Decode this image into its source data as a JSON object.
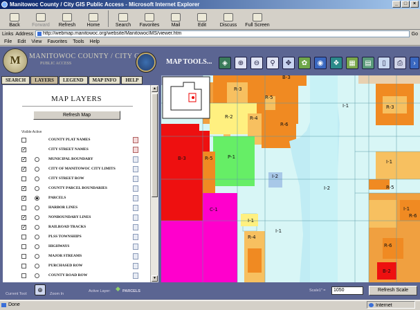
{
  "window": {
    "title": "Manitowoc County / City GIS Public Access - Microsoft Internet Explorer"
  },
  "toolbar": {
    "buttons": [
      "Back",
      "Forward",
      "Refresh",
      "Home",
      "Search",
      "Favorites",
      "Mail",
      "Edit",
      "Discuss",
      "Full Screen"
    ]
  },
  "address": {
    "links_label": "Links",
    "address_label": "Address",
    "url": "http://webmap.manitowoc.org/website/ManitowocIMS/viewer.htm",
    "go_label": "Go"
  },
  "menu": [
    "File",
    "Edit",
    "View",
    "Favorites",
    "Tools",
    "Help"
  ],
  "banner": {
    "title": "MANITOWOC COUNTY / CITY GIS",
    "subtitle": "PUBLIC ACCESS",
    "map_tools_label": "MAP TOOLS..."
  },
  "tabs": [
    "SEARCH",
    "LAYERS",
    "LEGEND",
    "MAP INFO",
    "HELP"
  ],
  "panel": {
    "title": "MAP LAYERS",
    "refresh_button": "Refresh Map",
    "visible_active_label": "Visible Active",
    "layers": [
      {
        "name": "COUNTY PLAT NAMES",
        "visible": false,
        "active_radio": false,
        "active": false
      },
      {
        "name": "CITY STREET NAMES",
        "visible": true,
        "active_radio": false,
        "active": false
      },
      {
        "name": "MUNICIPAL BOUNDARY",
        "visible": true,
        "active_radio": true,
        "active": false
      },
      {
        "name": "CITY OF MANITOWOC CITY LIMITS",
        "visible": true,
        "active_radio": true,
        "active": false
      },
      {
        "name": "CITY STREET ROW",
        "visible": false,
        "active_radio": true,
        "active": false
      },
      {
        "name": "COUNTY PARCEL BOUNDARIES",
        "visible": true,
        "active_radio": true,
        "active": false
      },
      {
        "name": "PARCELS",
        "visible": true,
        "active_radio": true,
        "active": true
      },
      {
        "name": "HARBOR LINES",
        "visible": false,
        "active_radio": true,
        "active": false
      },
      {
        "name": "NONBOUNDARY LINES",
        "visible": true,
        "active_radio": true,
        "active": false
      },
      {
        "name": "RAILROAD TRACKS",
        "visible": true,
        "active_radio": true,
        "active": false
      },
      {
        "name": "PLSS TOWNSHIPS",
        "visible": false,
        "active_radio": true,
        "active": false
      },
      {
        "name": "HIGHWAYS",
        "visible": false,
        "active_radio": true,
        "active": false
      },
      {
        "name": "MAJOR STREAMS",
        "visible": false,
        "active_radio": true,
        "active": false
      },
      {
        "name": "PURCHASED ROW",
        "visible": false,
        "active_radio": true,
        "active": false
      },
      {
        "name": "COUNTY ROAD ROW",
        "visible": false,
        "active_radio": true,
        "active": false
      }
    ]
  },
  "map": {
    "zones": [
      "R-3",
      "B-3",
      "R-5",
      "R-2",
      "R-4",
      "R-6",
      "I-1",
      "B-3",
      "R-5",
      "P-1",
      "I-2",
      "I-2",
      "C-1",
      "I-1",
      "R-4",
      "I-1",
      "R-3",
      "I-1",
      "R-5",
      "R-6",
      "B-2",
      "R-6",
      "I-1"
    ],
    "colors": {
      "water": "#c8ecf0",
      "industrial": "#d8f6f6",
      "commercial_red": "#ee1010",
      "c1_magenta": "#ff00cc",
      "park_green": "#66ee66",
      "r_orange": "#f08a22",
      "r_light": "#f7c060",
      "yellow": "#fff080"
    }
  },
  "bottom": {
    "current_tool_label": "Current Tool:",
    "current_tool": "Zoom In",
    "active_layer_label": "Active Layer:",
    "active_layer": "PARCELS",
    "scale_label": "Scale1\" =",
    "scale_value": "1050",
    "refresh_scale": "Refresh Scale"
  },
  "status": {
    "left": "Done",
    "right": "Internet"
  }
}
